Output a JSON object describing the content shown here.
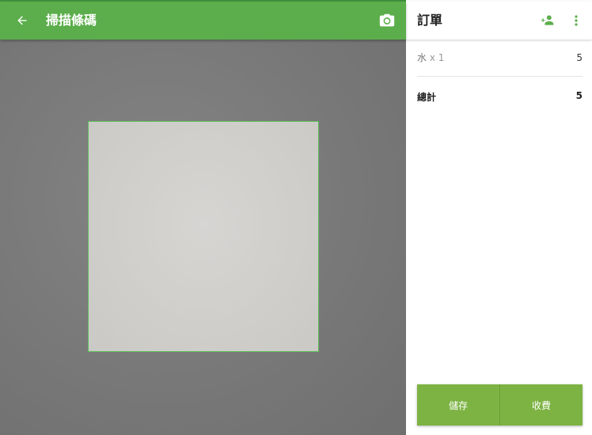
{
  "scanner": {
    "title": "掃描條碼",
    "icons": {
      "back": "arrow-back-icon",
      "camera": "camera-switch-icon"
    }
  },
  "order": {
    "title": "訂單",
    "icons": {
      "add_customer": "add-person-icon",
      "more": "more-vert-icon"
    },
    "items": [
      {
        "name": "水",
        "qty": "x 1",
        "price": "5"
      }
    ],
    "total_label": "總計",
    "total_value": "5",
    "save_label": "儲存",
    "charge_label": "收費"
  },
  "colors": {
    "toolbar": "#5bae4b",
    "action": "#7cb342",
    "scan_frame_border": "#5bbf5a"
  }
}
